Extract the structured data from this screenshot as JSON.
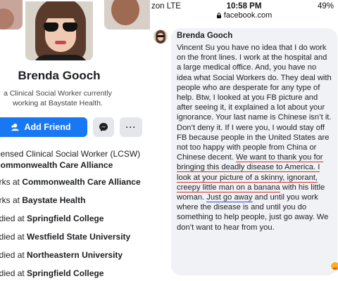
{
  "profile": {
    "name": "Brenda Gooch",
    "bio": "a Clinical Social Worker currently working at Baystate Health.",
    "buttons": {
      "add_friend": "Add Friend",
      "messenger_icon": "messenger-icon",
      "more": "···"
    },
    "details": [
      {
        "prefix": "icensed Clinical Social Worker (LCSW)",
        "bold": ""
      },
      {
        "prefix": "",
        "bold": "Commonwealth Care Alliance"
      },
      {
        "prefix": "orks at ",
        "bold": "Commonwealth Care Alliance"
      },
      {
        "prefix": "orks at ",
        "bold": "Baystate Health"
      },
      {
        "prefix": "udied at ",
        "bold": "Springfield College"
      },
      {
        "prefix": "udied at ",
        "bold": "Westfield State University"
      },
      {
        "prefix": "udied at ",
        "bold": "Northeastern University"
      },
      {
        "prefix": "udied at ",
        "bold": "Springfield College"
      }
    ]
  },
  "phone": {
    "carrier": "zon  LTE",
    "time": "10:58 PM",
    "battery": "49%",
    "url": "facebook.com"
  },
  "comment": {
    "author": "Brenda Gooch",
    "text_1": "Vincent Su you have no idea that I do work on the front lines. I work at the hospital and a large medical office. And, you have no idea what Social Workers do. They deal with people who are desperate for any type of help. Btw, I looked at you FB picture and after seeing it, it explained a lot about your ignorance. Your last name is Chinese isn’t it. Don’t deny it. If I were you, I would stay off FB because people in the United States are not too happy with people from China or Chinese decent. ",
    "text_red": "We want to thank you for bringing this deadly disease to America. I look at your picture of a skinny, ignorant, creepy little man on a banana",
    "text_2": " with his little woman. ",
    "text_blue": "Just go away",
    "text_3": " and until you work where the disease is and until you do something to help people, just go away. We don’t want to hear from you."
  },
  "colors": {
    "facebook_blue": "#1877f2",
    "underline_red": "#d62d2d",
    "underline_blue": "#2f49d1",
    "bubble_gray": "#f0f2f5"
  }
}
